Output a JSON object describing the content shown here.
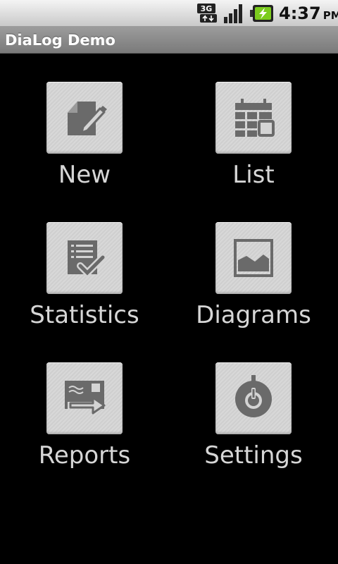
{
  "status_bar": {
    "network_type": "3G",
    "time": "4:37",
    "ampm": "PM",
    "icons": [
      "network-3g-icon",
      "signal-strength-icon",
      "battery-charging-icon"
    ]
  },
  "app": {
    "title": "DiaLog Demo"
  },
  "menu": {
    "items": [
      {
        "label": "New",
        "icon": "edit-note-icon"
      },
      {
        "label": "List",
        "icon": "calendar-icon"
      },
      {
        "label": "Statistics",
        "icon": "checklist-icon"
      },
      {
        "label": "Diagrams",
        "icon": "picture-icon"
      },
      {
        "label": "Reports",
        "icon": "send-report-icon"
      },
      {
        "label": "Settings",
        "icon": "power-knob-icon"
      }
    ]
  },
  "colors": {
    "background": "#000000",
    "title_bar": "#8a8a8a",
    "label": "#d6d6d6",
    "button": "#d4d4d4",
    "icon": "#6a6a6a"
  }
}
